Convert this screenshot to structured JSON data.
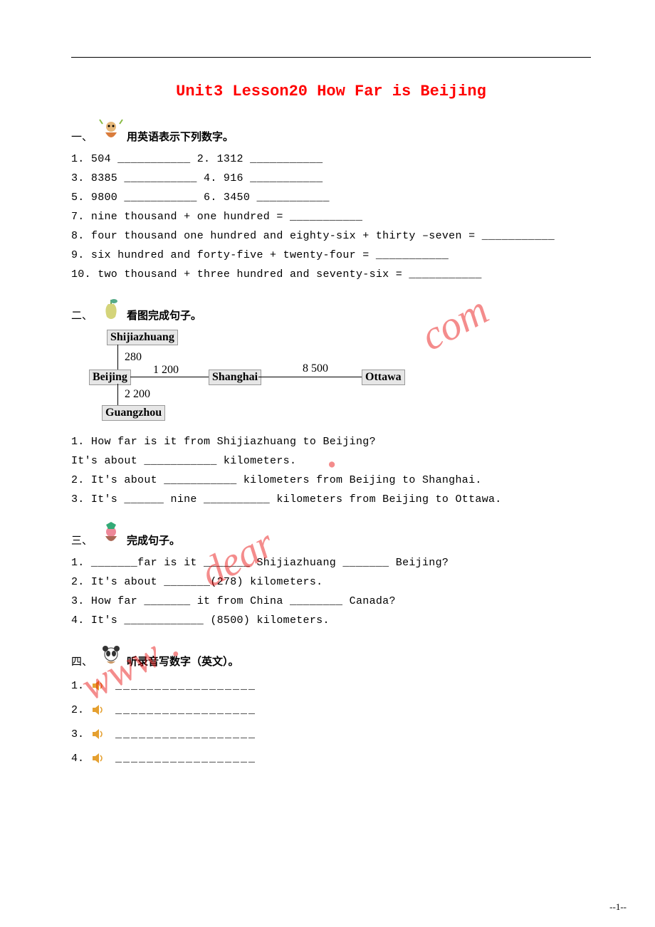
{
  "title": "Unit3 Lesson20 How Far is Beijing",
  "s1": {
    "label_num": "一、",
    "label_text": "用英语表示下列数字。",
    "l1": "1. 504 ___________ 2. 1312 ___________",
    "l2": "3. 8385 ___________ 4. 916 ___________",
    "l3": "5. 9800 ___________ 6. 3450 ___________",
    "l4": "7. nine thousand + one hundred = ___________",
    "l5": "8. four thousand one hundred and eighty-six + thirty –seven = ___________",
    "l6": "9. six hundred and forty-five + twenty-four = ___________",
    "l7": "10. two thousand + three hundred and seventy-six = ___________"
  },
  "s2": {
    "label_num": "二、",
    "label_text": "看图完成句子。",
    "diagram": {
      "shijiazhuang": "Shijiazhuang",
      "beijing": "Beijing",
      "shanghai": "Shanghai",
      "ottawa": "Ottawa",
      "guangzhou": "Guangzhou",
      "n280": "280",
      "n1200": "1 200",
      "n8500": "8 500",
      "n2200": "2 200"
    },
    "l1": "1. How far is it from Shijiazhuang to Beijing?",
    "l2": "It's about ___________ kilometers.",
    "l3": "2. It's about ___________ kilometers from Beijing to Shanghai.",
    "l4": "3. It's ______ nine __________ kilometers from Beijing to Ottawa."
  },
  "s3": {
    "label_num": "三、",
    "label_text": "完成句子。",
    "l1": "1. _______far is it _______ Shijiazhuang _______ Beijing?",
    "l2": "2. It's about _______(278) kilometers.",
    "l3": "3. How far _______ it from China ________ Canada?",
    "l4": "4. It's ____________ (8500) kilometers."
  },
  "s4": {
    "label_num": "四、",
    "label_text": "听录音写数字（英文）。",
    "items": [
      "1.",
      "2.",
      "3.",
      "4."
    ],
    "blank": "__________________"
  },
  "watermark": {
    "w1": "www .",
    "w2": "dear",
    "w3": ".",
    "w4": "com"
  },
  "page_num": "--1--"
}
